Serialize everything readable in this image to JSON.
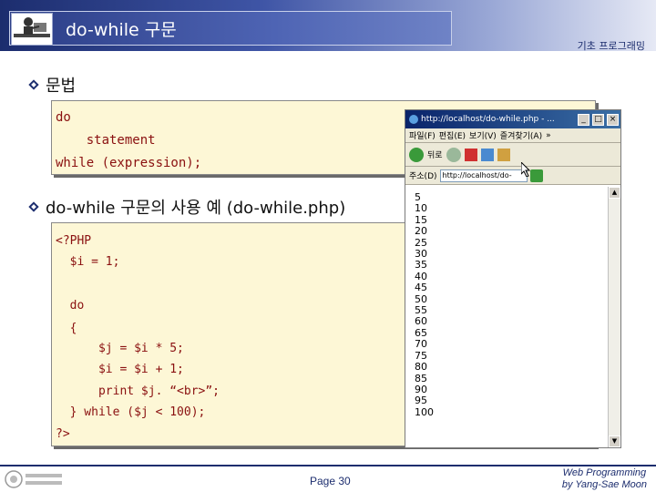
{
  "header": {
    "title": "do-while 구문",
    "course": "기초 프로그래밍"
  },
  "section1": {
    "heading": "문법",
    "code": [
      "do",
      "    statement",
      "while (expression);"
    ]
  },
  "section2": {
    "heading": "do-while 구문의 사용 예 (do-while.php)",
    "code": [
      "<?PHP",
      "  $i = 1;",
      "",
      "  do",
      "  {",
      "      $j = $i * 5;",
      "      $i = $i + 1;",
      "      print $j. “<br>”;",
      "  } while ($j < 100);",
      "?>"
    ]
  },
  "browser": {
    "title": "http://localhost/do-while.php - ...",
    "menu": [
      "파일(F)",
      "편집(E)",
      "보기(V)",
      "즐겨찾기(A)",
      "»"
    ],
    "back_label": "뒤로",
    "address_label": "주소(D)",
    "address": "http://localhost/do-",
    "output": [
      "5",
      "10",
      "15",
      "20",
      "25",
      "30",
      "35",
      "40",
      "45",
      "50",
      "55",
      "60",
      "65",
      "70",
      "75",
      "80",
      "85",
      "90",
      "95",
      "100"
    ]
  },
  "footer": {
    "page": "Page 30",
    "credit_line1": "Web Programming",
    "credit_line2": "by Yang-Sae Moon"
  },
  "colors": {
    "header_dark": "#1c2d6e",
    "code_background": "#fdf7d6",
    "code_text": "#8a1010"
  }
}
